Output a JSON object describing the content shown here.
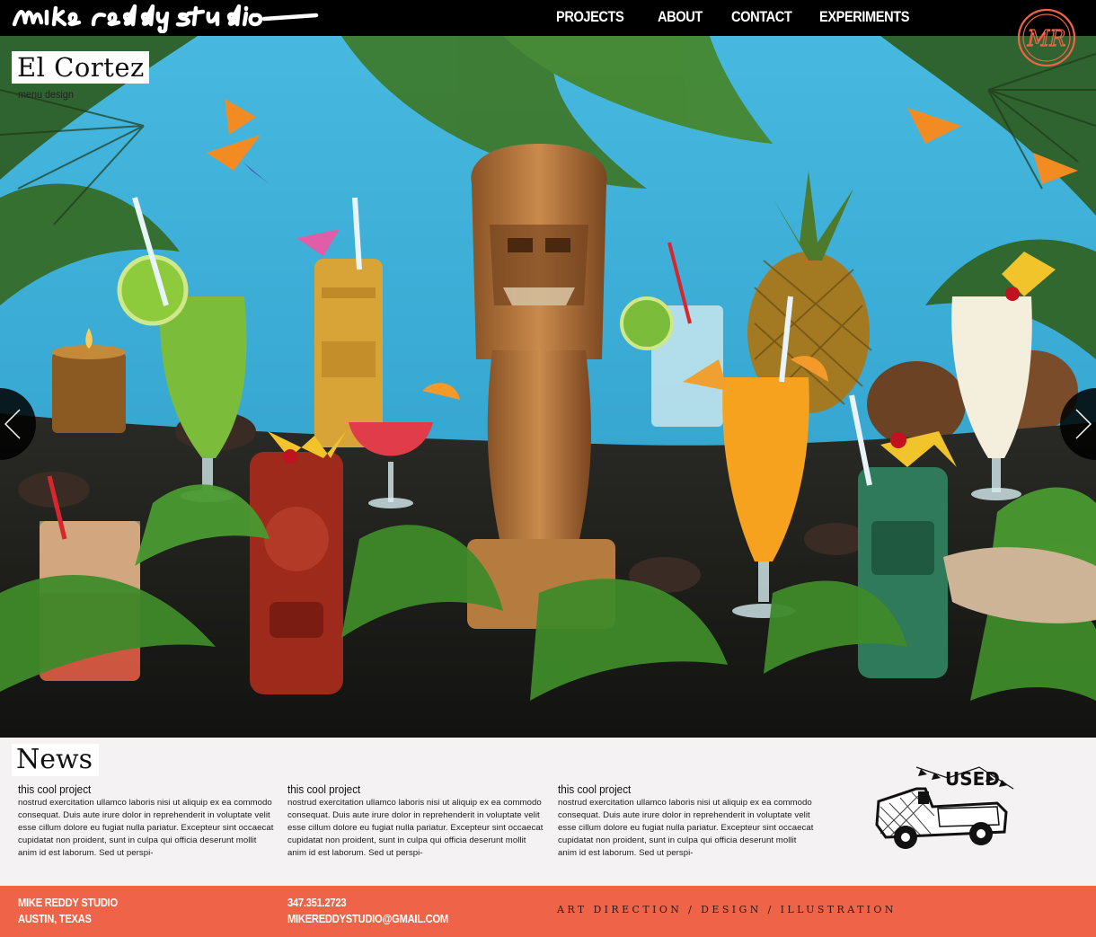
{
  "header": {
    "logo_text": "mike reddy studio",
    "nav": [
      {
        "label": "PROJECTS"
      },
      {
        "label": "ABOUT"
      },
      {
        "label": "CONTACT"
      },
      {
        "label": "EXPERIMENTS"
      }
    ],
    "badge_text": "MR"
  },
  "hero": {
    "title": "El Cortez",
    "subtitle": "menu design",
    "prev_icon": "chevron-left-icon",
    "next_icon": "chevron-right-icon"
  },
  "news": {
    "heading": "News",
    "items": [
      {
        "title": "this cool project",
        "body": "nostrud exercitation ullamco laboris nisi ut aliquip ex ea commodo consequat. Duis aute irure dolor in reprehenderit in voluptate velit esse cillum dolore eu fugiat nulla pariatur. Excepteur sint occaecat cupidatat non proident, sunt in culpa qui officia deserunt mollit anim id est laborum. Sed ut perspi-"
      },
      {
        "title": "this cool project",
        "body": "nostrud exercitation ullamco laboris nisi ut aliquip ex ea commodo consequat. Duis aute irure dolor in reprehenderit in voluptate velit esse cillum dolore eu fugiat nulla pariatur. Excepteur sint occaecat cupidatat non proident, sunt in culpa qui officia deserunt mollit anim id est laborum. Sed ut perspi-"
      },
      {
        "title": "this cool project",
        "body": "nostrud exercitation ullamco laboris nisi ut aliquip ex ea commodo consequat. Duis aute irure dolor in reprehenderit in voluptate velit esse cillum dolore eu fugiat nulla pariatur. Excepteur sint occaecat cupidatat non proident, sunt in culpa qui officia deserunt mollit anim id est laborum. Sed ut perspi-"
      }
    ],
    "truck_sign": "USED"
  },
  "footer": {
    "name": "MIKE REDDY STUDIO",
    "location": "AUSTIN, TEXAS",
    "phone": "347.351.2723",
    "email": "MIKEREDDYSTUDIO@GMAIL.COM",
    "tagline": "ART DIRECTION / DESIGN / ILLUSTRATION"
  },
  "colors": {
    "header_bg": "#000000",
    "accent": "#ef6448",
    "hero_sky": "#3cb3dc",
    "page_bg": "#f4f2f3"
  }
}
